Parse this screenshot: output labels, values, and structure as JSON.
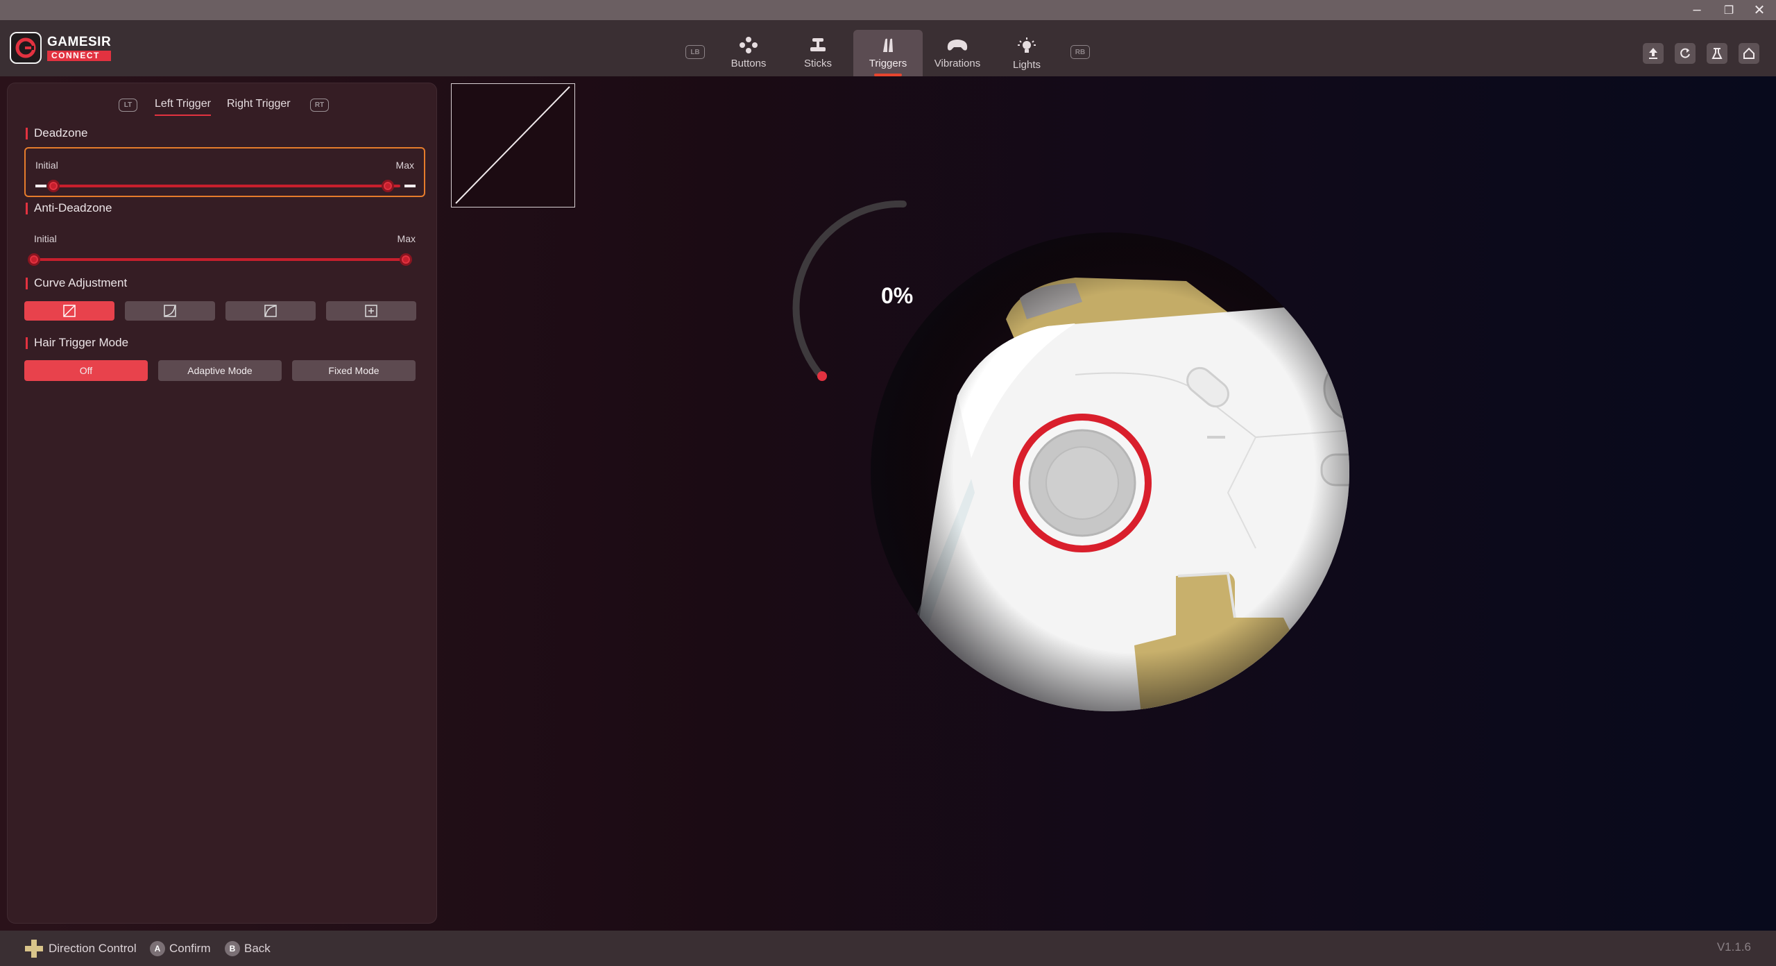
{
  "window": {
    "minimize_icon": "–",
    "restore_icon": "❐",
    "close_icon": "✕"
  },
  "logo": {
    "name": "GAMESIR",
    "sub": "CONNECT"
  },
  "nav": {
    "left_bumper": "LB",
    "right_bumper": "RB",
    "tabs": [
      {
        "label": "Buttons",
        "icon": "buttons-icon"
      },
      {
        "label": "Sticks",
        "icon": "sticks-icon"
      },
      {
        "label": "Triggers",
        "icon": "triggers-icon"
      },
      {
        "label": "Vibrations",
        "icon": "vibrations-icon"
      },
      {
        "label": "Lights",
        "icon": "lights-icon"
      }
    ],
    "active_tab": "Triggers"
  },
  "toolbar": {
    "icons": [
      "upload-icon",
      "reset-icon",
      "lab-icon",
      "home-icon"
    ]
  },
  "panel": {
    "lt_badge": "LT",
    "rt_badge": "RT",
    "sub_tabs": [
      "Left Trigger",
      "Right Trigger"
    ],
    "active_sub_tab": "Left Trigger",
    "deadzone": {
      "title": "Deadzone",
      "initial_label": "Initial",
      "max_label": "Max"
    },
    "anti_deadzone": {
      "title": "Anti-Deadzone",
      "initial_label": "Initial",
      "max_label": "Max"
    },
    "curve": {
      "title": "Curve Adjustment",
      "options": [
        "linear",
        "delayed",
        "aggressive",
        "custom"
      ],
      "selected": 0
    },
    "hair_trigger": {
      "title": "Hair Trigger Mode",
      "options": [
        "Off",
        "Adaptive Mode",
        "Fixed Mode"
      ],
      "selected": "Off"
    }
  },
  "trigger_gauge": {
    "value_text": "0%",
    "value": 0
  },
  "bottom": {
    "hints": [
      {
        "key": "+",
        "label": "Direction Control"
      },
      {
        "key": "A",
        "label": "Confirm"
      },
      {
        "key": "B",
        "label": "Back"
      }
    ],
    "version": "V1.1.6"
  },
  "colors": {
    "accent": "#e23240",
    "focus": "#e67c2c",
    "controller_gold": "#c9b26d"
  }
}
